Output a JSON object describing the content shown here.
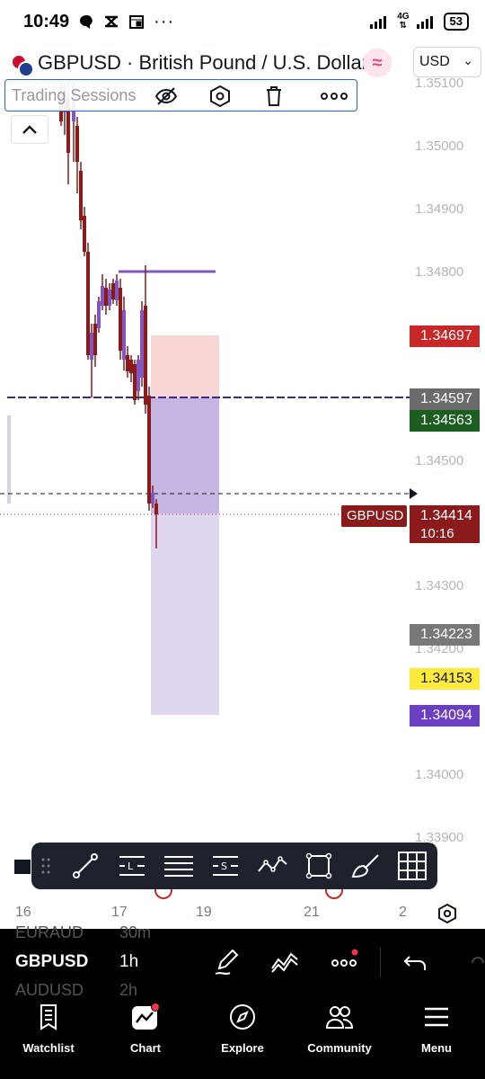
{
  "status_bar": {
    "time": "10:49",
    "network": "4G",
    "battery": "53"
  },
  "header": {
    "symbol_title": "GBPUSD · British Pound / U.S. Dollar",
    "currency": "USD"
  },
  "indicator": {
    "name": "Trading Sessions"
  },
  "price_axis": {
    "ticks": [
      "1.35100",
      "1.35000",
      "1.34900",
      "1.34800",
      "1.34500",
      "1.34300",
      "1.34200",
      "1.34000",
      "1.33900"
    ],
    "tags": [
      {
        "value": "1.34697",
        "color": "#c62828"
      },
      {
        "value": "1.34597",
        "color": "#6b6b6b"
      },
      {
        "value": "1.34563",
        "color": "#1b5e20"
      },
      {
        "value": "1.34223",
        "color": "#787878"
      },
      {
        "value": "1.34153",
        "color": "#ffeb3b"
      },
      {
        "value": "1.34094",
        "color": "#6a3fc4"
      }
    ],
    "last_price": {
      "symbol": "GBPUSD",
      "value": "1.34414",
      "countdown": "10:16",
      "color": "#8b1a1a"
    }
  },
  "x_axis": {
    "labels": [
      "16",
      "17",
      "19",
      "21",
      "2"
    ]
  },
  "bottom_panel": {
    "ghost_above": {
      "symbol": "EURAUD",
      "timeframe": "30m"
    },
    "current": {
      "symbol": "GBPUSD",
      "timeframe": "1h"
    },
    "ghost_below": {
      "symbol": "AUDUSD",
      "timeframe": "2h"
    }
  },
  "nav": [
    {
      "label": "Watchlist"
    },
    {
      "label": "Chart"
    },
    {
      "label": "Explore"
    },
    {
      "label": "Community"
    },
    {
      "label": "Menu"
    }
  ]
}
